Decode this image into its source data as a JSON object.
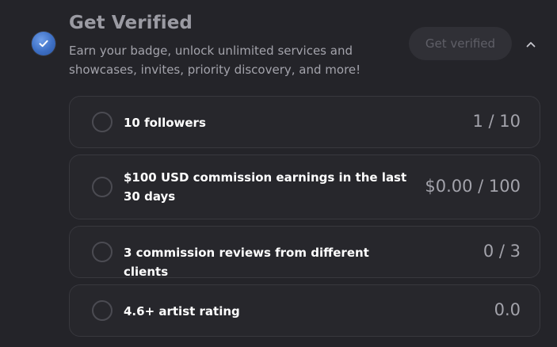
{
  "header": {
    "title": "Get Verified",
    "subtitle": "Earn your badge, unlock unlimited services and showcases, invites, priority discovery, and more!",
    "verify_button_label": "Get verified",
    "badge_icon": "verified-check-icon",
    "toggle_icon": "chevron-up-icon"
  },
  "requirements": [
    {
      "label": "10 followers",
      "progress": "1 / 10"
    },
    {
      "label": "$100 USD commission earnings in the last 30 days",
      "progress": "$0.00 / 100"
    },
    {
      "label": "3 commission reviews from different clients",
      "progress": "0 / 3"
    },
    {
      "label": "4.6+ artist rating",
      "progress": "0.0"
    }
  ],
  "colors": {
    "background": "#242429",
    "card_background": "#27272c",
    "card_border": "#38383e",
    "badge_blue": "#3d6fc4",
    "muted_text": "#a3a3ab"
  }
}
